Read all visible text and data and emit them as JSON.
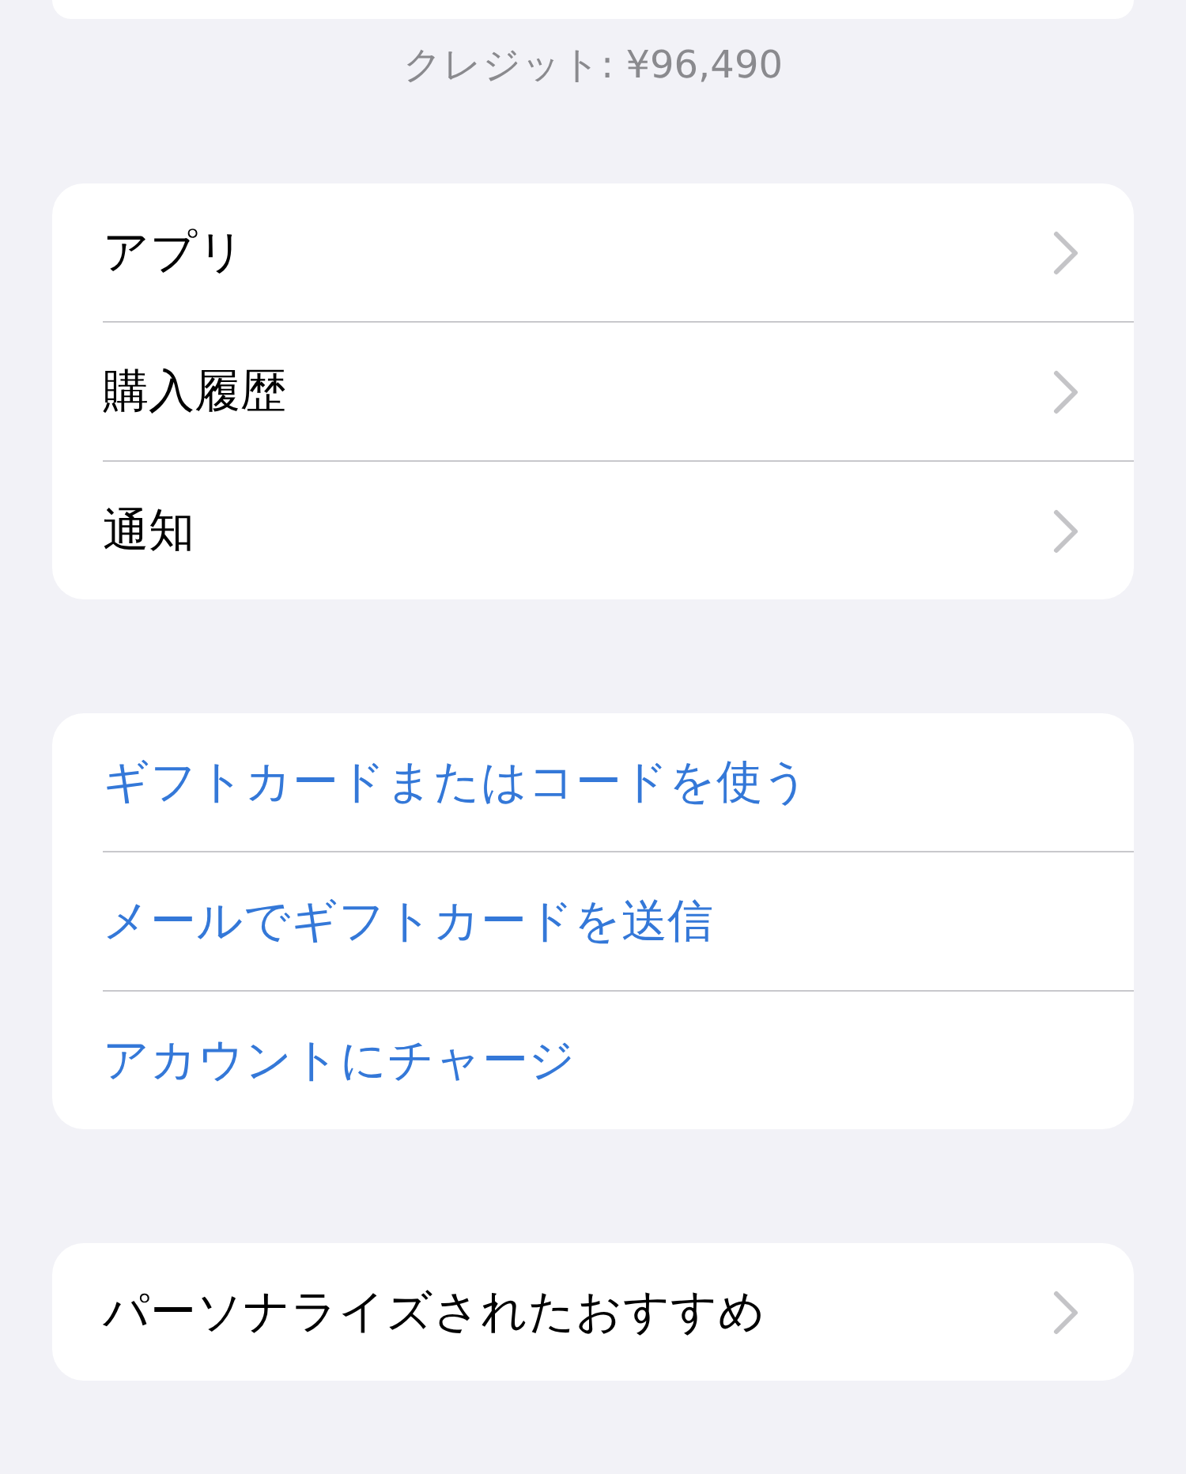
{
  "credit": "クレジット: ¥96,490",
  "sections": [
    {
      "items": [
        {
          "label": "アプリ",
          "kind": "nav"
        },
        {
          "label": "購入履歴",
          "kind": "nav"
        },
        {
          "label": "通知",
          "kind": "nav"
        }
      ]
    },
    {
      "items": [
        {
          "label": "ギフトカードまたはコードを使う",
          "kind": "action"
        },
        {
          "label": "メールでギフトカードを送信",
          "kind": "action"
        },
        {
          "label": "アカウントにチャージ",
          "kind": "action"
        }
      ]
    },
    {
      "items": [
        {
          "label": "パーソナライズされたおすすめ",
          "kind": "nav"
        }
      ]
    }
  ]
}
